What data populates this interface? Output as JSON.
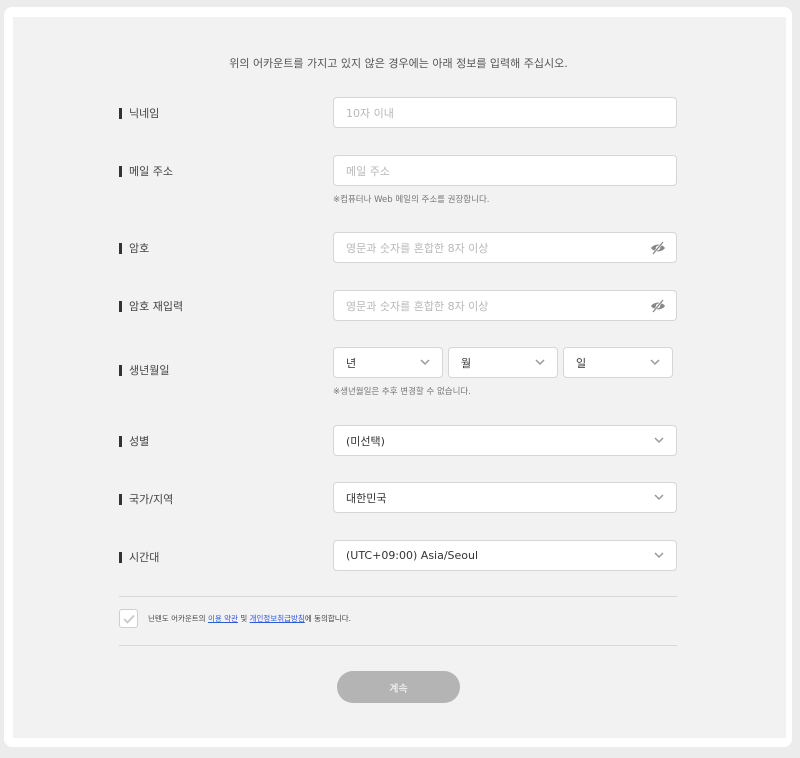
{
  "intro": "위의 어카운트를 가지고 있지 않은 경우에는 아래 정보를 입력해 주십시오.",
  "nickname": {
    "label": "닉네임",
    "placeholder": "10자 이내"
  },
  "email": {
    "label": "메일 주소",
    "placeholder": "메일 주소",
    "hint": "※컴퓨터나 Web 메일의 주소를 권장합니다."
  },
  "password": {
    "label": "암호",
    "placeholder": "영문과 숫자를 혼합한 8자 이상"
  },
  "password_confirm": {
    "label": "암호 재입력",
    "placeholder": "영문과 숫자를 혼합한 8자 이상"
  },
  "birth": {
    "label": "생년월일",
    "year": "년",
    "month": "월",
    "day": "일",
    "hint": "※생년월일은 추후 변경할 수 없습니다."
  },
  "gender": {
    "label": "성별",
    "value": "(미선택)"
  },
  "country": {
    "label": "국가/지역",
    "value": "대한민국"
  },
  "timezone": {
    "label": "시간대",
    "value": "(UTC+09:00) Asia/Seoul"
  },
  "agreement": {
    "prefix": "닌텐도 어카운트의 ",
    "terms_link": "이용 약관",
    "middle": " 및 ",
    "privacy_link": "개인정보취급방침",
    "suffix": "에 동의합니다."
  },
  "continue_label": "계속",
  "colors": {
    "accent_link": "#2b5bd7",
    "button_disabled": "#b4b4b4",
    "panel": "#f2f2f2"
  }
}
